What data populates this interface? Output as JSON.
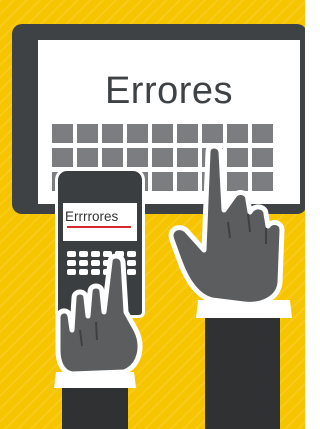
{
  "tablet": {
    "word": "Errores"
  },
  "phone": {
    "word": "Errrrores"
  },
  "colors": {
    "background": "#f7c500",
    "device": "#3e4245",
    "key": "#7b7d80",
    "hand": "#5b5d5f",
    "sleeve": "#2f3133",
    "typo_underline": "#d7282f"
  },
  "icons": [
    "tablet",
    "smartphone",
    "pointing-hand-left",
    "pointing-hand-right"
  ]
}
